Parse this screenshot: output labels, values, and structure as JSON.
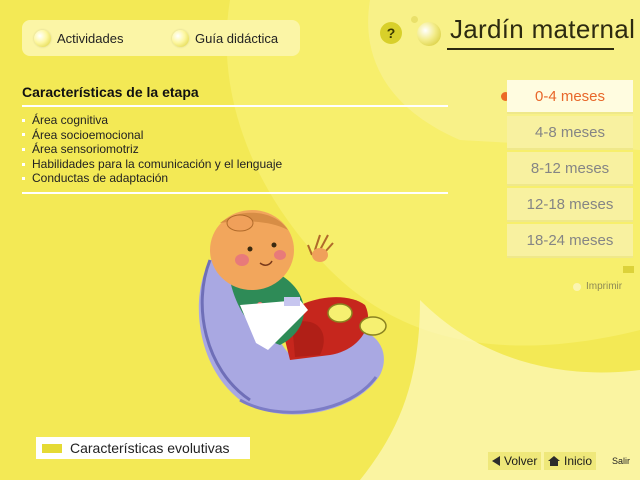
{
  "nav": {
    "activities_label": "Actividades",
    "guide_label": "Guía didáctica",
    "help_label": "?"
  },
  "app": {
    "title": "Jardín maternal"
  },
  "content": {
    "section_title": "Características de la etapa",
    "topics": [
      "Área cognitiva",
      "Área socioemocional",
      "Área sensoriomotriz",
      "Habilidades para la comunicación y el lenguaje",
      "Conductas de adaptación"
    ]
  },
  "age_tabs": {
    "selected": "0-4 meses",
    "items": [
      "0-4 meses",
      "4-8 meses",
      "8-12 meses",
      "12-18 meses",
      "18-24 meses"
    ]
  },
  "print_label": "Imprimir",
  "footer": {
    "section_label": "Características evolutivas",
    "back_label": "Volver",
    "home_label": "Inicio",
    "exit_label": "Salir"
  },
  "colors": {
    "background": "#f7ef6c",
    "accent_orange": "#ec6a26",
    "tab_active_bg": "#fffce0",
    "tab_inactive_text": "#858585"
  },
  "icons": {
    "nav_bullet": "bulb-icon",
    "help": "help-icon",
    "back": "arrow-left-icon",
    "home": "home-icon"
  }
}
